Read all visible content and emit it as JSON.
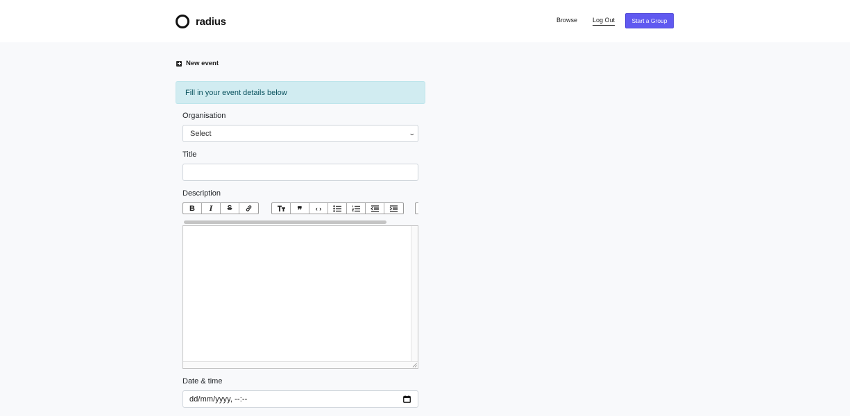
{
  "header": {
    "brand": "radius",
    "nav": {
      "browse": "Browse",
      "logout": "Log Out",
      "start_group": "Start a Group"
    }
  },
  "page": {
    "title": "New event",
    "alert": "Fill in your event details below"
  },
  "form": {
    "organisation": {
      "label": "Organisation",
      "value": "Select"
    },
    "title": {
      "label": "Title",
      "value": ""
    },
    "description": {
      "label": "Description",
      "toolbar": [
        "bold",
        "italic",
        "strikethrough",
        "link",
        "heading",
        "quote",
        "code",
        "bullet-list",
        "numbered-list",
        "outdent",
        "indent"
      ]
    },
    "datetime": {
      "label": "Date & time",
      "placeholder": "dd/mm/yyyy, --:--"
    }
  },
  "colors": {
    "accent": "#6059f0",
    "alert_bg": "#d1ecf1",
    "alert_text": "#0c5460"
  }
}
